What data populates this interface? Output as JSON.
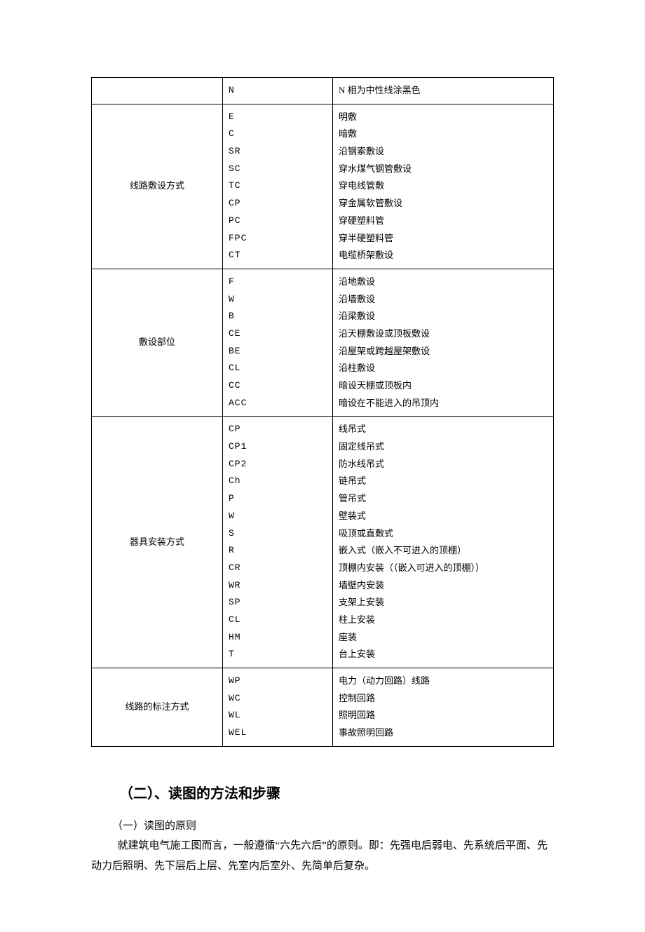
{
  "table": {
    "rows": [
      {
        "category": "",
        "codes": [
          "N"
        ],
        "descs": [
          "N 相为中性线涂黑色"
        ]
      },
      {
        "category": "线路敷设方式",
        "codes": [
          "E",
          "C",
          "SR",
          "SC",
          "TC",
          "CP",
          "PC",
          "FPC",
          "CT"
        ],
        "descs": [
          "明敷",
          "暗敷",
          "沿钢索敷设",
          "穿水煤气钢管敷设",
          "穿电线管敷",
          "穿金属软管敷设",
          "穿硬塑料管",
          "穿半硬塑料管",
          "电缆桥架敷设"
        ]
      },
      {
        "category": "敷设部位",
        "codes": [
          "F",
          "W",
          "B",
          "CE",
          "BE",
          "CL",
          "CC",
          "ACC"
        ],
        "descs": [
          "沿地敷设",
          "沿墙敷设",
          "沿梁敷设",
          "沿天棚敷设或顶板敷设",
          "沿屋架或跨越屋架敷设",
          "沿柱敷设",
          "暗设天棚或顶板内",
          "暗设在不能进入的吊顶内"
        ]
      },
      {
        "category": "器具安装方式",
        "codes": [
          "CP",
          "CP1",
          "CP2",
          "Ch",
          "P",
          "W",
          "S",
          "R",
          "CR",
          "WR",
          "SP",
          "CL",
          "HM",
          "T"
        ],
        "descs": [
          "线吊式",
          "固定线吊式",
          "防水线吊式",
          "链吊式",
          "管吊式",
          "壁装式",
          "吸顶或直敷式",
          "嵌入式（嵌入不可进入的顶棚）",
          "顶棚内安装（（嵌入可进入的顶棚））",
          "墙壁内安装",
          "支架上安装",
          "柱上安装",
          "座装",
          "台上安装"
        ]
      },
      {
        "category": "线路的标注方式",
        "codes": [
          "WP",
          "WC",
          "WL",
          "WEL"
        ],
        "descs": [
          "电力（动力回路）线路",
          "控制回路",
          "照明回路",
          "事故照明回路"
        ]
      }
    ]
  },
  "section_heading": "（二）、读图的方法和步骤",
  "paragraphs": {
    "p1": "（一）读图的原则",
    "p2": "就建筑电气施工图而言，一般遵循“六先六后”的原则。即：先强电后弱电、先系统后平面、先动力后照明、先下层后上层、先室内后室外、先简单后复杂。"
  }
}
